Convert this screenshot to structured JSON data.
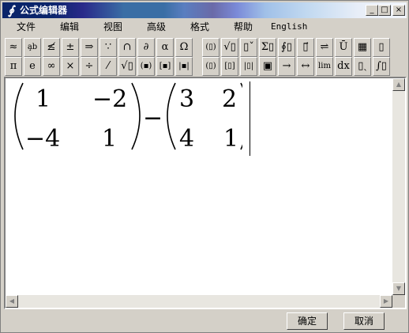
{
  "window": {
    "title": "公式编辑器",
    "app_icon_glyph": "∮"
  },
  "title_buttons": {
    "minimize": "_",
    "maximize": "□",
    "close": "×"
  },
  "menu": [
    {
      "label": "文件",
      "en": false
    },
    {
      "label": "编辑",
      "en": false
    },
    {
      "label": "视图",
      "en": false
    },
    {
      "label": "高级",
      "en": false
    },
    {
      "label": "格式",
      "en": false
    },
    {
      "label": "帮助",
      "en": false
    },
    {
      "label": "English",
      "en": true
    }
  ],
  "toolbar1": [
    {
      "name": "approx-icon",
      "glyph": "≈"
    },
    {
      "name": "space-icon",
      "glyph": "a̧b"
    },
    {
      "name": "embellishment-icon",
      "glyph": "≰"
    },
    {
      "name": "plus-minus-icon",
      "glyph": "±"
    },
    {
      "name": "arrows-icon",
      "glyph": "⇒"
    },
    {
      "name": "logic-icon",
      "glyph": "∵"
    },
    {
      "name": "set-icon",
      "glyph": "∩"
    },
    {
      "name": "partial-icon",
      "glyph": "∂"
    },
    {
      "name": "greek-lower-icon",
      "glyph": "α"
    },
    {
      "name": "greek-upper-icon",
      "glyph": "Ω"
    },
    {
      "name": "fence-template-icon",
      "glyph": "(▯)"
    },
    {
      "name": "fraction-radical-icon",
      "glyph": "√▯"
    },
    {
      "name": "subscript-template-icon",
      "glyph": "▯ˇ"
    },
    {
      "name": "summation-template-icon",
      "glyph": "Σ▯"
    },
    {
      "name": "integral-template-icon",
      "glyph": "∮▯"
    },
    {
      "name": "underbar-template-icon",
      "glyph": "▯⃗"
    },
    {
      "name": "arrow-template-icon",
      "glyph": "⇌"
    },
    {
      "name": "product-template-icon",
      "glyph": "Ū"
    },
    {
      "name": "matrix-template-icon",
      "glyph": "▦"
    },
    {
      "name": "box-template-icon",
      "glyph": "▯"
    }
  ],
  "toolbar2": [
    {
      "name": "pi-icon",
      "glyph": "π"
    },
    {
      "name": "e-icon",
      "glyph": "e"
    },
    {
      "name": "infinity-icon",
      "glyph": "∞"
    },
    {
      "name": "times-icon",
      "glyph": "×"
    },
    {
      "name": "divide-icon",
      "glyph": "÷"
    },
    {
      "name": "fraction-icon",
      "glyph": "⁄"
    },
    {
      "name": "sqrt-icon",
      "glyph": "√▯"
    },
    {
      "name": "parens-icon",
      "glyph": "(▪)"
    },
    {
      "name": "brackets-icon",
      "glyph": "[▪]"
    },
    {
      "name": "abs-icon",
      "glyph": "|▪|"
    },
    {
      "name": "paren-template-icon",
      "glyph": "(▯)"
    },
    {
      "name": "bracket-template-icon",
      "glyph": "[▯]"
    },
    {
      "name": "bar-template-icon",
      "glyph": "|▯|"
    },
    {
      "name": "matrix-small-icon",
      "glyph": "▣"
    },
    {
      "name": "right-arrow-icon",
      "glyph": "→"
    },
    {
      "name": "left-right-arrow-icon",
      "glyph": "↔"
    },
    {
      "name": "limit-icon",
      "glyph": "lim"
    },
    {
      "name": "dx-icon",
      "glyph": "dx"
    },
    {
      "name": "subscript-icon",
      "glyph": "▯ˎ"
    },
    {
      "name": "integral-small-icon",
      "glyph": "∫▯"
    }
  ],
  "formula": {
    "left_matrix": [
      [
        "1",
        "−2"
      ],
      [
        "−4",
        "1"
      ]
    ],
    "operator": "−",
    "right_matrix": [
      [
        "3",
        "2"
      ],
      [
        "4",
        "1"
      ]
    ]
  },
  "scroll": {
    "up": "▲",
    "down": "▼",
    "left": "◀",
    "right": "▶"
  },
  "buttons": {
    "ok": "确定",
    "cancel": "取消"
  }
}
